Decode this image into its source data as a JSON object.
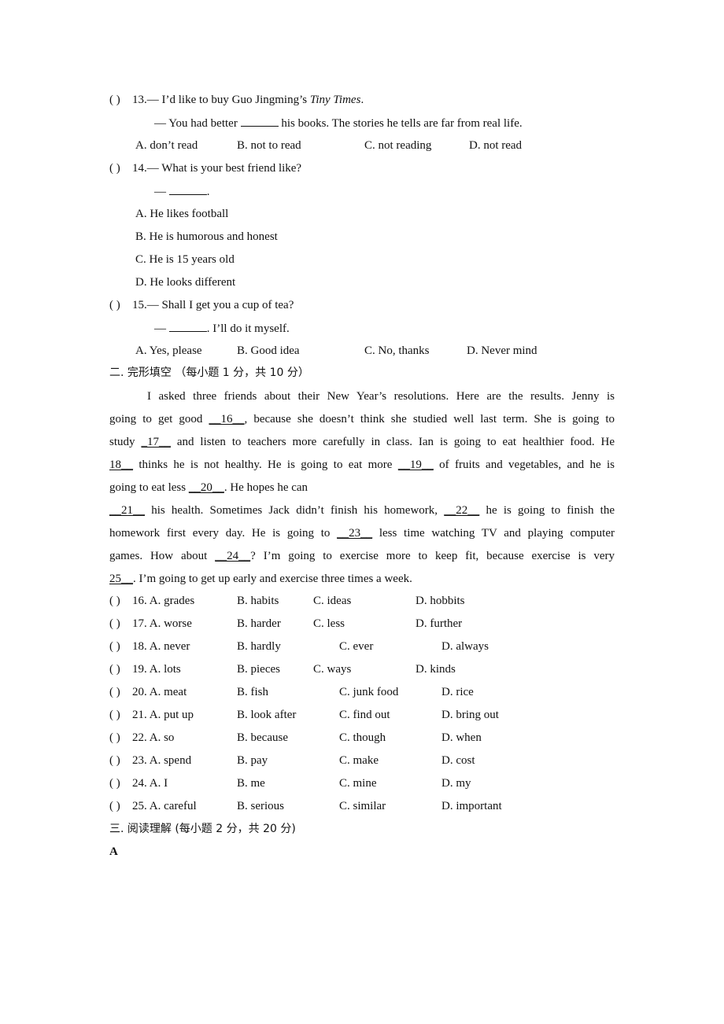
{
  "questions_mc": [
    {
      "paren": "(      )",
      "num": "13.",
      "stem_prefix": "— I’d like to buy Guo Jingming’s ",
      "stem_italic": "Tiny Times",
      "stem_suffix": ".",
      "reply_prefix": "— You had better ",
      "reply_suffix": " his books. The stories he tells are far from real life.",
      "options": [
        "A. don’t read",
        "B. not to read",
        "C. not reading",
        "D. not read"
      ]
    },
    {
      "paren": "(      )",
      "num": "14.",
      "stem": "— What is your best friend like?",
      "reply_prefix": "— ",
      "reply_suffix": ".",
      "options": [
        "A. He likes football",
        "B. He is humorous and honest",
        "C. He is 15 years old",
        "D. He looks different"
      ]
    },
    {
      "paren": "(      )",
      "num": "15.",
      "stem": "— Shall I get you a cup of tea?",
      "reply_prefix": "— ",
      "reply_suffix": ". I’ll do it myself.",
      "options": [
        "A. Yes, please",
        "B. Good idea",
        "C. No, thanks",
        "D. Never mind"
      ]
    }
  ],
  "section2": {
    "heading": "二. 完形填空 （每小题 1 分，共 10 分）",
    "passage_lines": [
      [
        "I asked three friends about their New Year’s resolutions. Here are the results. Jenny is"
      ],
      [
        "going to get good ",
        "__16__",
        ", because she doesn’t think she studied   well last term. She is going to"
      ],
      [
        "study ",
        "_17__",
        " and listen to teachers more carefully in class. Ian is going to eat healthier food. He"
      ],
      [
        "18__",
        " thinks he is not healthy. He is going to eat more ",
        "__19__",
        " of fruits and vegetables, and he is"
      ],
      [
        "going to eat less ",
        "__20__",
        ". He hopes he can"
      ],
      [
        "__21__",
        " his health. Sometimes Jack didn’t finish his homework, ",
        "__22__",
        " he is going to finish the"
      ],
      [
        "homework first every day. He is going to ",
        "__23__",
        " less time watching TV and playing computer"
      ],
      [
        "games. How about ",
        "__24__",
        "? I’m going to exercise more to keep fit, because exercise is very"
      ],
      [
        "25__",
        ". I’m going to get up early and exercise three times a week."
      ]
    ],
    "questions": [
      {
        "paren": "(      )",
        "num": "16.",
        "options": [
          "A. grades",
          "B. habits",
          "C. ideas",
          "D. hobbits"
        ]
      },
      {
        "paren": "(      )",
        "num": "17.",
        "options": [
          "A. worse",
          "B. harder",
          "C. less",
          "D. further"
        ]
      },
      {
        "paren": "(      )",
        "num": "18.",
        "options": [
          "A. never",
          "B. hardly",
          "C. ever",
          "D. always"
        ]
      },
      {
        "paren": "(      )",
        "num": "19.",
        "options": [
          "A. lots",
          "B. pieces",
          "C. ways",
          "D. kinds"
        ]
      },
      {
        "paren": "(      )",
        "num": "20.",
        "options": [
          "A. meat",
          "B. fish",
          "C. junk food",
          "D. rice"
        ]
      },
      {
        "paren": "(      )",
        "num": "21.",
        "options": [
          "A. put up",
          "B. look after",
          "C. find out",
          "D. bring out"
        ]
      },
      {
        "paren": "(      )",
        "num": "22.",
        "options": [
          "A. so",
          "B. because",
          "C. though",
          "D. when"
        ]
      },
      {
        "paren": "(      )",
        "num": "23.",
        "options": [
          "A. spend",
          "B. pay",
          "C. make",
          "D. cost"
        ]
      },
      {
        "paren": "(      )",
        "num": "24.",
        "options": [
          "A. I",
          "B. me",
          "C. mine",
          "D. my"
        ]
      },
      {
        "paren": "(      )",
        "num": "25.",
        "options": [
          "A. careful",
          "B. serious",
          "C. similar",
          "D. important"
        ]
      }
    ]
  },
  "section3": {
    "heading": "三. 阅读理解 (每小题 2 分，共 20 分)",
    "subheading": "A"
  }
}
